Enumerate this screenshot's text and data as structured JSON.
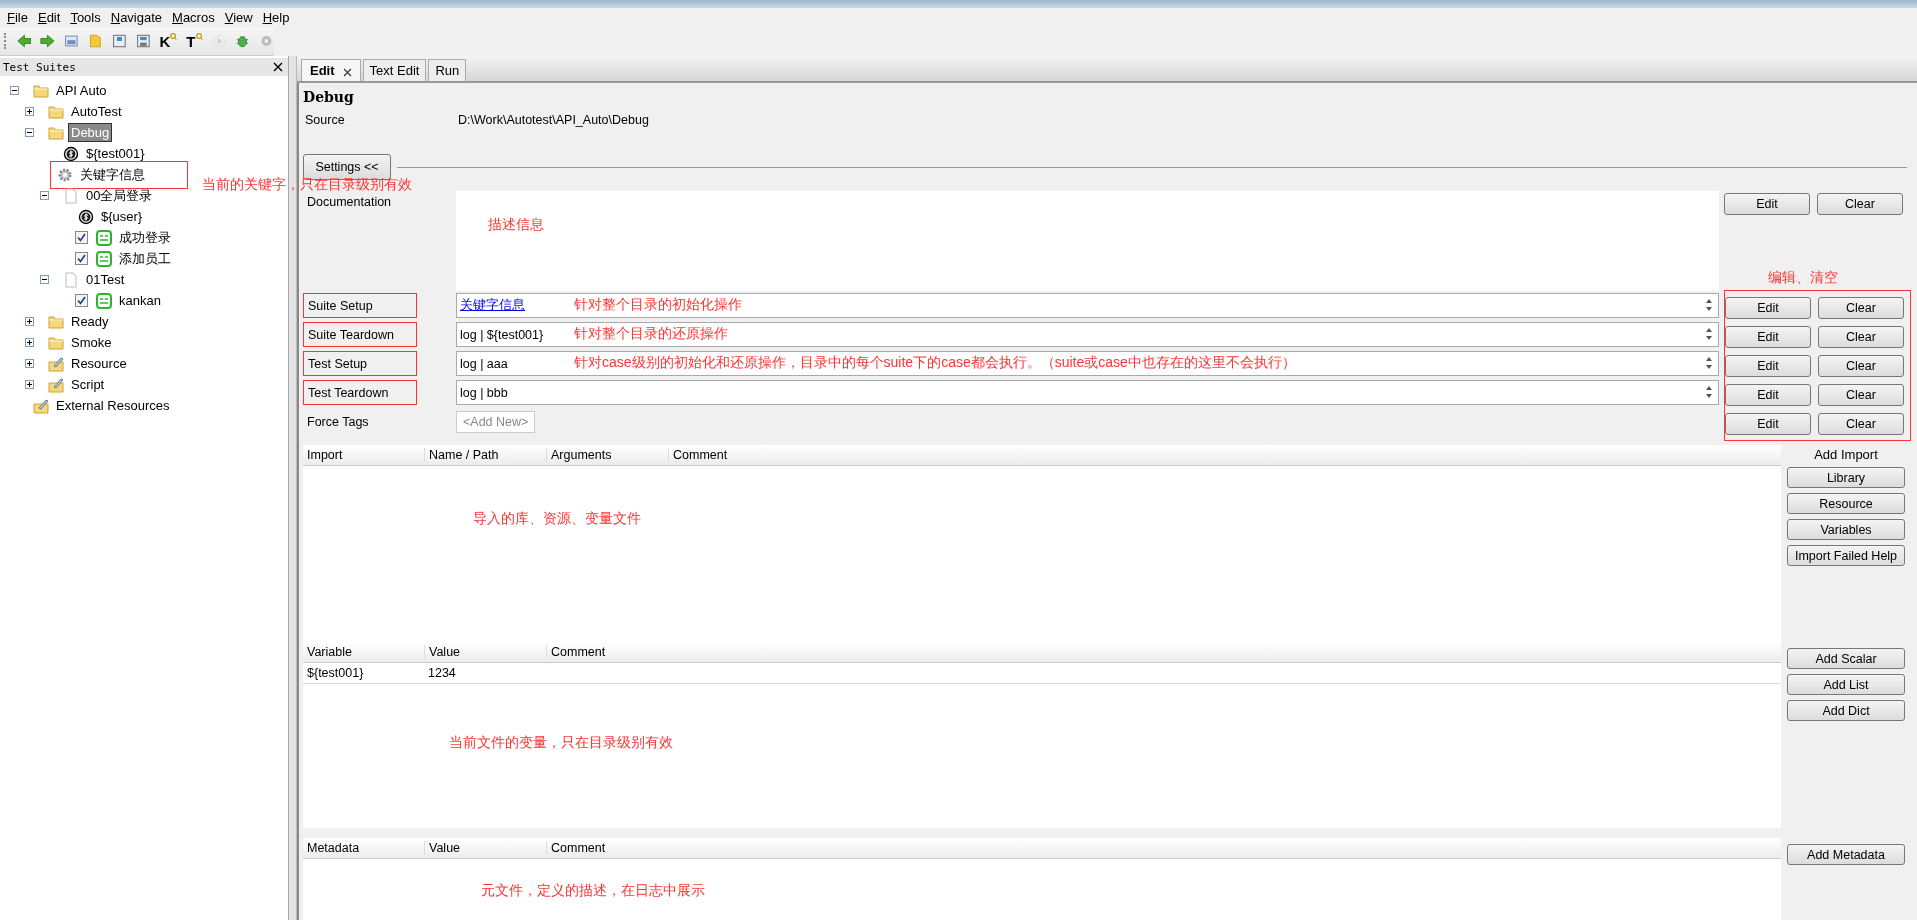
{
  "menu": [
    "File",
    "Edit",
    "Tools",
    "Navigate",
    "Macros",
    "View",
    "Help"
  ],
  "toolbar": [
    {
      "kind": "back",
      "disabled": false
    },
    {
      "kind": "forward",
      "disabled": false
    },
    {
      "kind": "open",
      "disabled": false
    },
    {
      "kind": "folder",
      "disabled": false
    },
    {
      "kind": "save",
      "disabled": false
    },
    {
      "kind": "save-all",
      "disabled": false
    },
    {
      "kind": "search",
      "text": "K",
      "disabled": false
    },
    {
      "kind": "search",
      "text": "T",
      "disabled": false
    },
    {
      "kind": "run",
      "disabled": true
    },
    {
      "kind": "bug",
      "disabled": false
    },
    {
      "kind": "stop",
      "disabled": true
    }
  ],
  "tree": {
    "title": "Test Suites",
    "nodes": [
      {
        "label": "API Auto",
        "kind": "folder",
        "expanded": true,
        "selected": false,
        "children": [
          {
            "label": "AutoTest",
            "kind": "folder",
            "expanded": false,
            "selected": false
          },
          {
            "label": "Debug",
            "kind": "folder",
            "expanded": true,
            "selected": true,
            "children": [
              {
                "label": "${test001}",
                "kind": "variable",
                "selected": false
              },
              {
                "label": "关键字信息",
                "kind": "keyword",
                "selected": false,
                "boxed": true,
                "note": "当前的关键字，只在目录级别有效"
              },
              {
                "label": "00全局登录",
                "kind": "file",
                "expanded": true,
                "selected": false,
                "children": [
                  {
                    "label": "${user}",
                    "kind": "variable",
                    "selected": false
                  },
                  {
                    "label": "成功登录",
                    "kind": "test",
                    "checked": true,
                    "selected": false
                  },
                  {
                    "label": "添加员工",
                    "kind": "test",
                    "checked": true,
                    "selected": false
                  }
                ]
              },
              {
                "label": "01Test",
                "kind": "file",
                "expanded": true,
                "selected": false,
                "children": [
                  {
                    "label": "kankan",
                    "kind": "test",
                    "checked": true,
                    "selected": false
                  }
                ]
              }
            ]
          },
          {
            "label": "Ready",
            "kind": "folder",
            "expanded": false,
            "selected": false
          },
          {
            "label": "Smoke",
            "kind": "folder",
            "expanded": false,
            "selected": false
          },
          {
            "label": "Resource",
            "kind": "resource",
            "expanded": false,
            "selected": false
          },
          {
            "label": "Script",
            "kind": "resource",
            "expanded": false,
            "selected": false
          }
        ]
      },
      {
        "label": "External Resources",
        "kind": "resource",
        "selected": false
      }
    ]
  },
  "tabs": [
    {
      "label": "Edit",
      "selected": true,
      "closable": true
    },
    {
      "label": "Text Edit",
      "selected": false,
      "closable": false
    },
    {
      "label": "Run",
      "selected": false,
      "closable": false
    }
  ],
  "editor": {
    "title": "Debug",
    "source": {
      "label": "Source",
      "value": "D:\\Work\\Autotest\\API_Auto\\Debug"
    },
    "settings_toggle": "Settings <<",
    "settings": [
      {
        "kind": "doc",
        "label": "Documentation",
        "boxed": false,
        "note": "描述信息",
        "buttons": [
          "Edit",
          "Clear"
        ],
        "buttons_boxed": false
      },
      {
        "kind": "field",
        "label": "Suite Setup",
        "value": "关键字信息",
        "link": true,
        "boxed": true,
        "note": "针对整个目录的初始化操作",
        "buttons": [
          "Edit",
          "Clear"
        ],
        "buttons_boxed": true
      },
      {
        "kind": "field",
        "label": "Suite Teardown",
        "value": "log | ${test001}",
        "link": false,
        "boxed": true,
        "note": "针对整个目录的还原操作",
        "buttons": [
          "Edit",
          "Clear"
        ],
        "buttons_boxed": true
      },
      {
        "kind": "field",
        "label": "Test Setup",
        "value": "log | aaa",
        "link": false,
        "boxed": true,
        "note": "针对case级别的初始化和还原操作，目录中的每个suite下的case都会执行。（suite或case中也存在的这里不会执行）",
        "buttons": [
          "Edit",
          "Clear"
        ],
        "buttons_boxed": true
      },
      {
        "kind": "field",
        "label": "Test Teardown",
        "value": "log | bbb",
        "link": false,
        "boxed": true,
        "buttons": [
          "Edit",
          "Clear"
        ],
        "buttons_boxed": true
      },
      {
        "kind": "tags",
        "label": "Force Tags",
        "value": "<Add New>",
        "boxed": false,
        "buttons": [
          "Edit",
          "Clear"
        ],
        "buttons_boxed": true
      }
    ],
    "buttons_note": "编辑、清空",
    "tables": [
      {
        "columns": [
          "Import",
          "Name / Path",
          "Arguments",
          "Comment"
        ],
        "note": "导入的库、资源、变量文件",
        "actions_title": "Add Import",
        "actions": [
          "Library",
          "Resource",
          "Variables",
          "Import Failed Help"
        ]
      },
      {
        "columns": [
          "Variable",
          "Value",
          "Comment"
        ],
        "rows": [
          [
            "${test001}",
            "1234"
          ]
        ],
        "note": "当前文件的变量，只在目录级别有效",
        "actions": [
          "Add Scalar",
          "Add List",
          "Add Dict"
        ]
      },
      {
        "columns": [
          "Metadata",
          "Value",
          "Comment"
        ],
        "note": "元文件，定义的描述，在日志中展示",
        "actions": [
          "Add Metadata"
        ]
      }
    ]
  }
}
